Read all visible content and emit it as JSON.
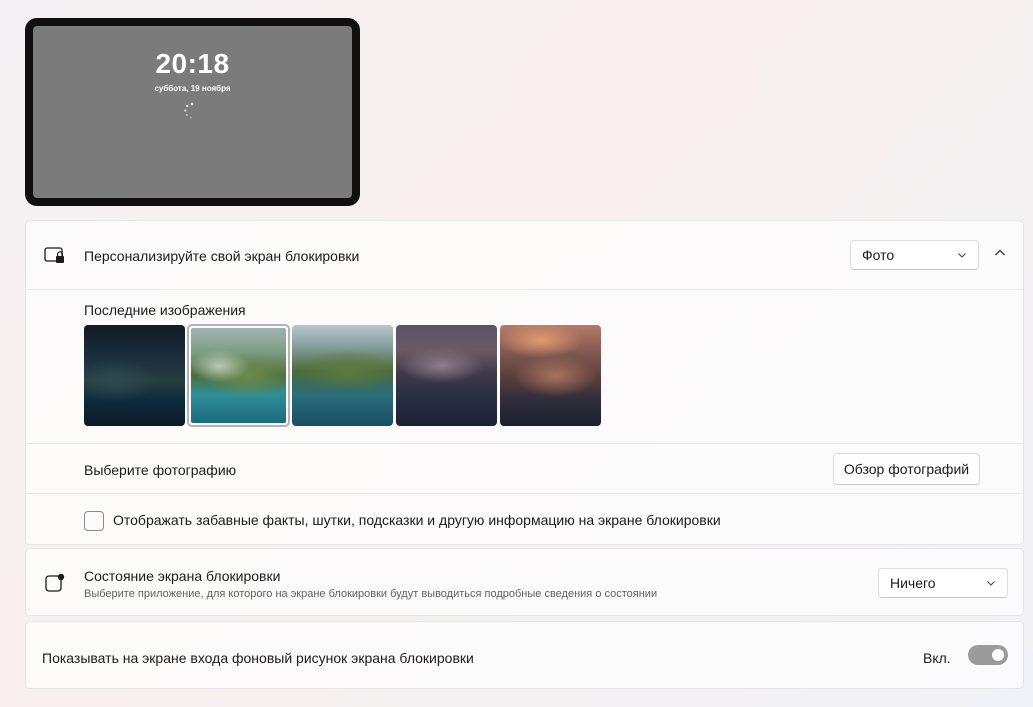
{
  "preview": {
    "time": "20:18",
    "date": "суббота, 19 ноября"
  },
  "personalize": {
    "title": "Персонализируйте свой экран блокировки",
    "dropdown_value": "Фото",
    "recent_label": "Последние изображения",
    "selected_thumbnail_index": 1,
    "thumbnail_count": 5,
    "choose_label": "Выберите фотографию",
    "browse_button": "Обзор фотографий",
    "facts_label": "Отображать забавные факты, шутки, подсказки и другую информацию на экране блокировки",
    "facts_checked": false
  },
  "status": {
    "title": "Состояние экрана блокировки",
    "subtitle": "Выберите приложение, для которого на экране блокировки будут выводиться подробные сведения о состоянии",
    "dropdown_value": "Ничего"
  },
  "signin": {
    "label": "Показывать на экране входа фоновый рисунок экрана блокировки",
    "state_label": "Вкл.",
    "toggle_on": true
  },
  "icons": {
    "lock_screen": "lock-screen-icon",
    "status": "status-badge-icon",
    "chevron_down": "chevron-down-icon",
    "chevron_up": "chevron-up-icon",
    "spinner": "loading-spinner-icon"
  }
}
